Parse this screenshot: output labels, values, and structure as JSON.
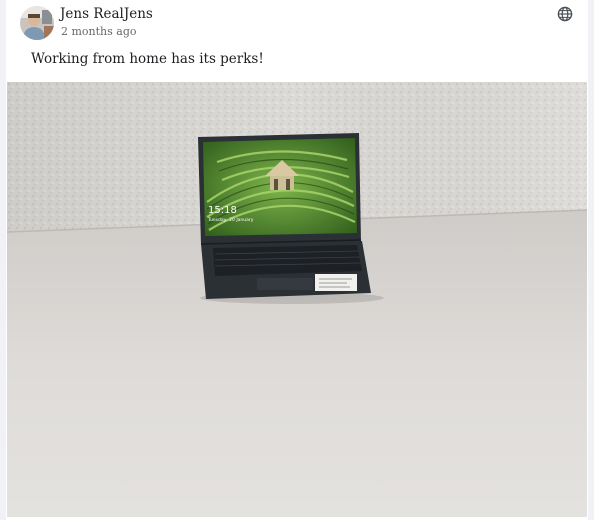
{
  "post": {
    "author_name": "Jens RealJens",
    "timestamp": "2 months ago",
    "privacy_icon": "globe-icon",
    "text": "Working from home has its perks!"
  },
  "photo": {
    "laptop_time": "15:18",
    "laptop_date": "Tuesday, 20 January",
    "colors": {
      "wall": "#dedcd8",
      "desk": "#dcd9d6",
      "laptop": "#2b3035",
      "screen_green": "#4f8a2c"
    }
  }
}
